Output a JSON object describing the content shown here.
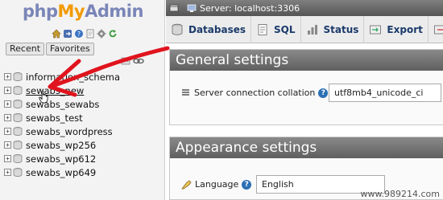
{
  "logo": {
    "part_php": "php",
    "part_my": "My",
    "part_admin": "Admin"
  },
  "nav_icons": [
    "home-icon",
    "logout-icon",
    "docs-icon",
    "sql-docs-icon",
    "settings-icon",
    "reload-icon"
  ],
  "nav_tabs": {
    "recent": "Recent",
    "favorites": "Favorites"
  },
  "databases": [
    {
      "name": "information_schema",
      "active": false
    },
    {
      "name": "sewabs_new",
      "active": true
    },
    {
      "name": "sewabs_sewabs",
      "active": false
    },
    {
      "name": "sewabs_test",
      "active": false
    },
    {
      "name": "sewabs_wordpress",
      "active": false
    },
    {
      "name": "sewabs_wp256",
      "active": false
    },
    {
      "name": "sewabs_wp612",
      "active": false
    },
    {
      "name": "sewabs_wp649",
      "active": false
    }
  ],
  "server_bar": {
    "label": "Server: localhost:3306"
  },
  "tabs": [
    {
      "label": "Databases",
      "icon": "databases-icon"
    },
    {
      "label": "SQL",
      "icon": "sql-icon"
    },
    {
      "label": "Status",
      "icon": "status-icon"
    },
    {
      "label": "Export",
      "icon": "export-icon"
    }
  ],
  "general_settings": {
    "title": "General settings",
    "collation_label": "Server connection collation",
    "collation_value": "utf8mb4_unicode_ci"
  },
  "appearance_settings": {
    "title": "Appearance settings",
    "language_label": "Language",
    "language_value": "English"
  },
  "watermark": "www.989214.com",
  "colors": {
    "annotation_arrow": "#e0141e",
    "header_gradient_top": "#8a8a8a",
    "link_blue": "#1b3a6b"
  }
}
